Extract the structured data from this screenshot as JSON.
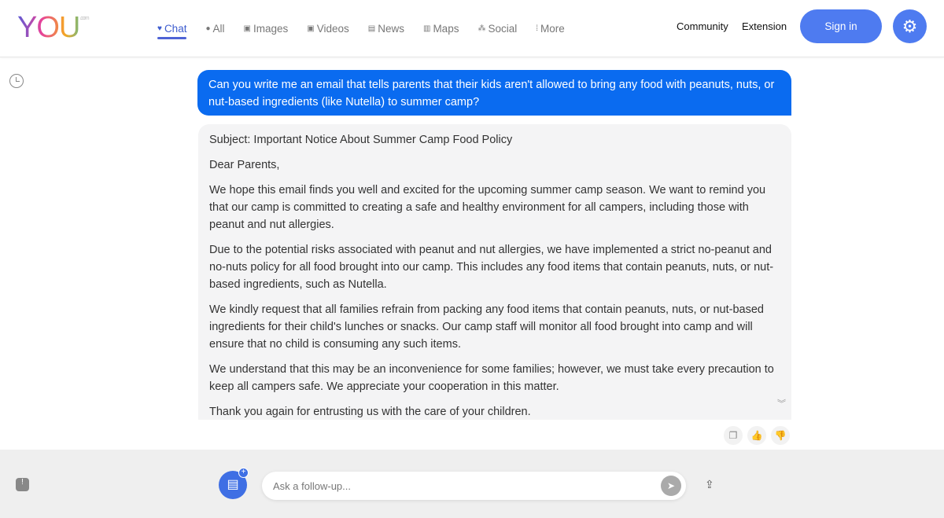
{
  "header": {
    "logo": "YOU",
    "logo_suffix": ".com",
    "tabs": [
      {
        "label": "Chat",
        "icon": "heart-chat-icon",
        "active": true
      },
      {
        "label": "All",
        "icon": "search-icon"
      },
      {
        "label": "Images",
        "icon": "image-icon"
      },
      {
        "label": "Videos",
        "icon": "video-icon"
      },
      {
        "label": "News",
        "icon": "news-icon"
      },
      {
        "label": "Maps",
        "icon": "map-icon"
      },
      {
        "label": "Social",
        "icon": "people-icon"
      },
      {
        "label": "More",
        "icon": "dots-icon"
      }
    ],
    "community": "Community",
    "extension": "Extension",
    "signin": "Sign in"
  },
  "chat": {
    "user_message": "Can you write me an email that tells parents that their kids aren't allowed to bring any food with peanuts, nuts, or nut-based ingredients (like Nutella) to summer camp?",
    "response": [
      "Subject: Important Notice About Summer Camp Food Policy",
      "Dear Parents,",
      "We hope this email finds you well and excited for the upcoming summer camp season. We want to remind you that our camp is committed to creating a safe and healthy environment for all campers, including those with peanut and nut allergies.",
      "Due to the potential risks associated with peanut and nut allergies, we have implemented a strict no-peanut and no-nuts policy for all food brought into our camp. This includes any food items that contain peanuts, nuts, or nut-based ingredients, such as Nutella.",
      "We kindly request that all families refrain from packing any food items that contain peanuts, nuts, or nut-based ingredients for their child's lunches or snacks. Our camp staff will monitor all food brought into camp and will ensure that no child is consuming any such items.",
      "We understand that this may be an inconvenience for some families; however, we must take every precaution to keep all campers safe. We appreciate your cooperation in this matter.",
      "Thank you again for entrusting us with the care of your children."
    ]
  },
  "input": {
    "placeholder": "Ask a follow-up..."
  },
  "colors": {
    "accent": "#4e7bf0",
    "user_bubble": "#0a6bf0"
  }
}
